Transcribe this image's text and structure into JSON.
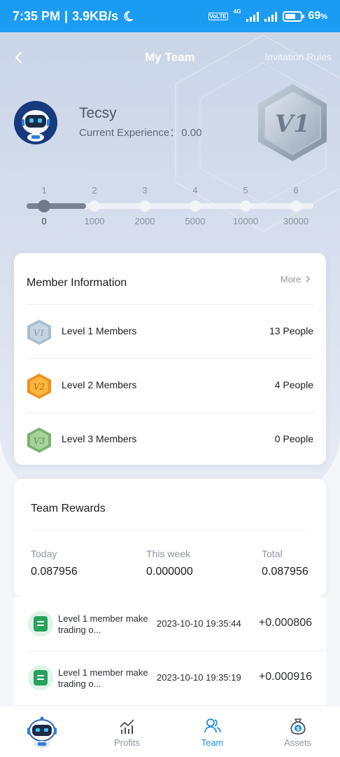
{
  "status_bar": {
    "time": "7:35 PM",
    "separator": "|",
    "net_speed": "3.9KB/s",
    "volte": "VoLTE",
    "network": "4G",
    "battery": "69",
    "battery_unit": "%",
    "battery_level": 0.69
  },
  "header": {
    "title": "My Team",
    "rules_link": "Invitation Rules"
  },
  "profile": {
    "name": "Tecsy",
    "exp_label": "Current Experience：",
    "exp_value": "0.00",
    "badge_text": "V1"
  },
  "level_progress": {
    "levels": [
      "1",
      "2",
      "3",
      "4",
      "5",
      "6"
    ],
    "thresholds": [
      "0",
      "1000",
      "2000",
      "5000",
      "10000",
      "30000"
    ],
    "current_index": 0
  },
  "member_info": {
    "title": "Member Information",
    "more_label": "More",
    "rows": [
      {
        "label": "Level 1 Members",
        "count": "13 People",
        "badge": "V1",
        "color": "#a9bccf"
      },
      {
        "label": "Level 2 Members",
        "count": "4 People",
        "badge": "V2",
        "color": "#f3a329"
      },
      {
        "label": "Level 3 Members",
        "count": "0 People",
        "badge": "V3",
        "color": "#8ec386"
      }
    ]
  },
  "team_rewards": {
    "title": "Team Rewards",
    "today_label": "Today",
    "today_value": "0.087956",
    "week_label": "This week",
    "week_value": "0.000000",
    "total_label": "Total",
    "total_value": "0.087956"
  },
  "records": [
    {
      "desc": "Level 1 member make trading o...",
      "time": "2023-10-10 19:35:44",
      "amount": "+0.000806"
    },
    {
      "desc": "Level 1 member make trading o...",
      "time": "2023-10-10 19:35:19",
      "amount": "+0.000916"
    }
  ],
  "tabbar": {
    "tabs": [
      {
        "label": "",
        "icon": "robot-icon"
      },
      {
        "label": "Profits",
        "icon": "chart-icon"
      },
      {
        "label": "Team",
        "icon": "team-icon"
      },
      {
        "label": "Assets",
        "icon": "money-bag-icon"
      }
    ],
    "active": "Team",
    "accent": "#1a8ee9"
  },
  "colors": {
    "status_bar": "#1a9cf2",
    "accent": "#1a8ee9"
  }
}
